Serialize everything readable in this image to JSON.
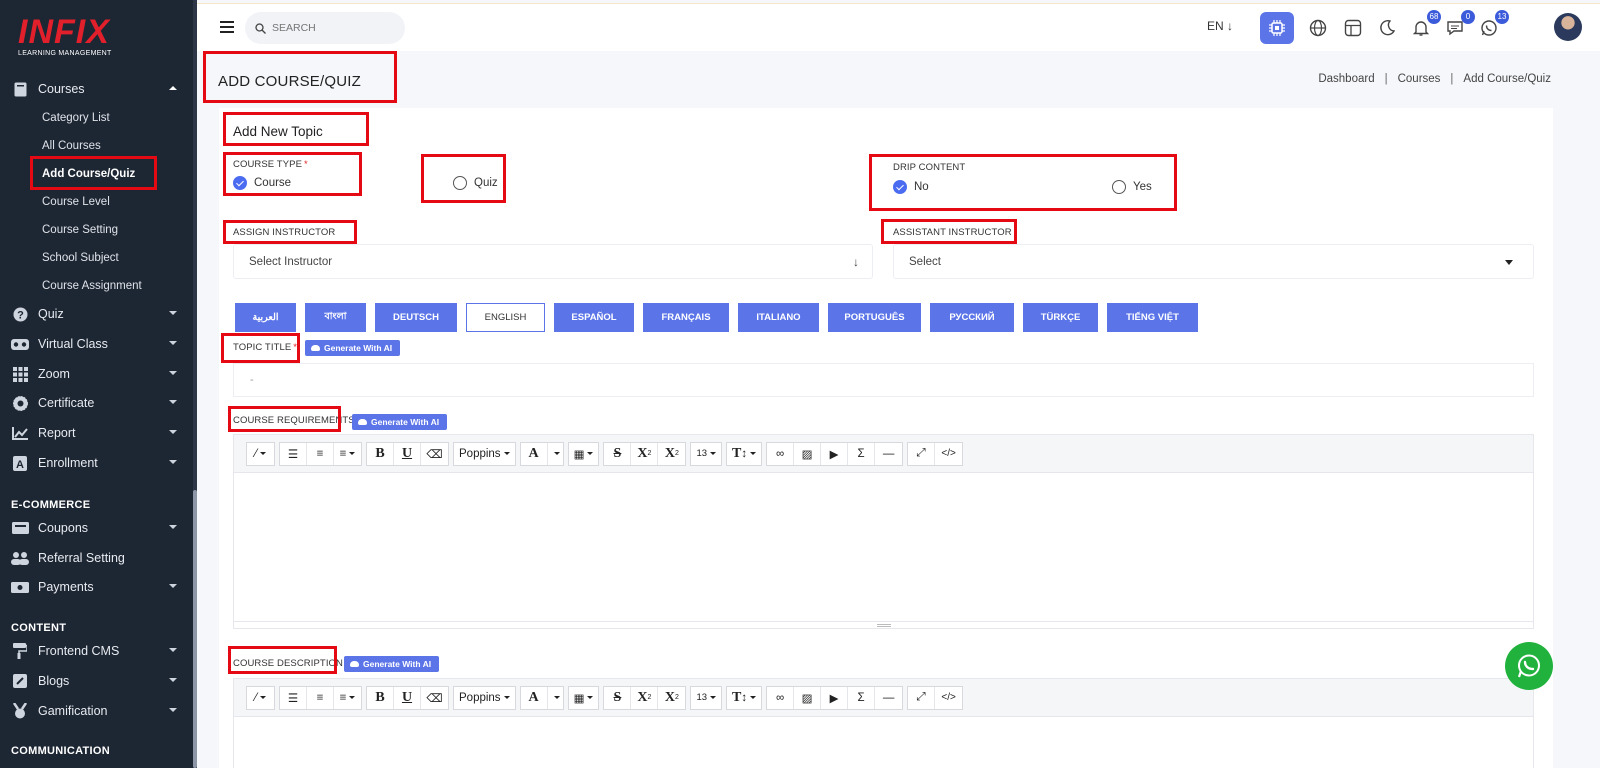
{
  "brand": {
    "logo_text": "INFIX",
    "logo_sub": "LEARNING MANAGEMENT"
  },
  "sidebar": {
    "menu": [
      {
        "label": "Courses",
        "icon": "book-icon",
        "expanded": true
      },
      {
        "label": "Quiz",
        "icon": "question-circle-icon"
      },
      {
        "label": "Virtual Class",
        "icon": "vr-headset-icon"
      },
      {
        "label": "Zoom",
        "icon": "grid-icon"
      },
      {
        "label": "Certificate",
        "icon": "certificate-badge-icon"
      },
      {
        "label": "Report",
        "icon": "chart-icon"
      },
      {
        "label": "Enrollment",
        "icon": "enrollment-icon"
      }
    ],
    "courses_sub": [
      "Category List",
      "All Courses",
      "Add Course/Quiz",
      "Course Level",
      "Course Setting",
      "School Subject",
      "Course Assignment"
    ],
    "sections": {
      "ecommerce": "E-COMMERCE",
      "content": "CONTENT",
      "communication": "COMMUNICATION"
    },
    "ecommerce_items": [
      {
        "label": "Coupons",
        "icon": "coupon-icon"
      },
      {
        "label": "Referral Setting",
        "icon": "users-icon"
      },
      {
        "label": "Payments",
        "icon": "money-icon"
      }
    ],
    "content_items": [
      {
        "label": "Frontend CMS",
        "icon": "paint-roller-icon"
      },
      {
        "label": "Blogs",
        "icon": "edit-icon"
      },
      {
        "label": "Gamification",
        "icon": "medal-icon"
      }
    ]
  },
  "header": {
    "search_placeholder": "SEARCH",
    "language": "EN ↓",
    "badges": {
      "notifications": "68",
      "messages": "0",
      "chat": "13"
    }
  },
  "page": {
    "title": "ADD COURSE/QUIZ",
    "breadcrumb": [
      "Dashboard",
      "Courses",
      "Add Course/Quiz"
    ]
  },
  "form": {
    "card_title": "Add New Topic",
    "course_type": {
      "label": "COURSE TYPE",
      "options": [
        "Course",
        "Quiz"
      ],
      "selected": "Course"
    },
    "drip_content": {
      "label": "DRIP CONTENT",
      "options": [
        "No",
        "Yes"
      ],
      "selected": "No"
    },
    "assign_instructor": {
      "label": "ASSIGN INSTRUCTOR",
      "value": "Select Instructor"
    },
    "assistant_instructor": {
      "label": "ASSISTANT INSTRUCTOR",
      "value": "Select"
    },
    "languages": [
      "العربية",
      "বাংলা",
      "DEUTSCH",
      "ENGLISH",
      "ESPAÑOL",
      "FRANÇAIS",
      "ITALIANO",
      "PORTUGUÊS",
      "РУССКИЙ",
      "TÜRKÇE",
      "TIẾNG VIỆT"
    ],
    "active_language": "ENGLISH",
    "topic_title": {
      "label": "TOPIC TITLE",
      "value": "-"
    },
    "course_requirements": {
      "label": "COURSE REQUIREMENTS"
    },
    "course_description": {
      "label": "COURSE DESCRIPTION"
    },
    "ai_button": "Generate With AI",
    "editor": {
      "font": "Poppins",
      "font_size": "13"
    }
  },
  "colors": {
    "accent": "#5b74e8",
    "sidebar": "#1d2633",
    "highlight": "#e50914",
    "whatsapp": "#21b23e"
  }
}
